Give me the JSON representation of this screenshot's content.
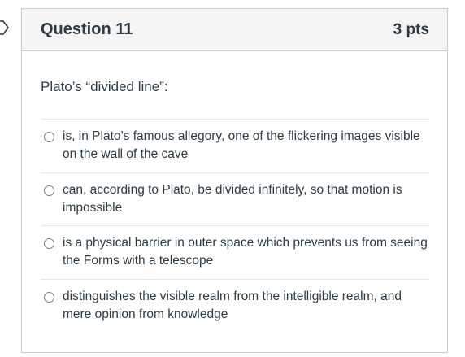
{
  "question": {
    "title": "Question 11",
    "points": "3 pts",
    "prompt": "Plato’s “divided line”:",
    "answers": [
      {
        "label": "is, in Plato’s famous allegory, one of the flickering images visible on the wall of the cave",
        "selected": false
      },
      {
        "label": "can, according to Plato, be divided infinitely, so that motion is impossible",
        "selected": false
      },
      {
        "label": "is a physical barrier in outer space which prevents us from seeing the Forms with a telescope",
        "selected": false
      },
      {
        "label": "distinguishes the visible realm from the intelligible realm, and mere opinion from knowledge",
        "selected": false
      }
    ]
  },
  "colors": {
    "header_bg": "#f5f5f5",
    "border": "#c7cdd1",
    "text": "#2d3b45",
    "radio_border": "#73818c"
  },
  "icons": {
    "flag": "flag-marker-icon"
  }
}
